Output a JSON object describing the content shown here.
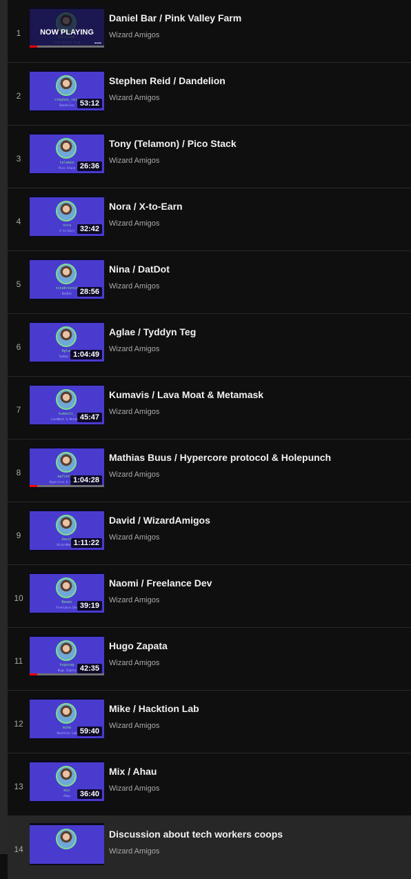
{
  "playlist": {
    "channel": "Wizard Amigos",
    "now_playing_label": "NOW PLAYING",
    "now_playing_dots": "---",
    "items": [
      {
        "index": "1",
        "title": "Daniel Bar / Pink Valley Farm",
        "duration": "",
        "thumb_name": "danielbar",
        "thumb_sub": "Pink Valley Farm",
        "progress": 0.1,
        "now_playing": true
      },
      {
        "index": "2",
        "title": "Stephen Reid / Dandelion",
        "duration": "53:12",
        "thumb_name": "stephen_reid",
        "thumb_sub": "Dandelion",
        "progress": 0
      },
      {
        "index": "3",
        "title": "Tony (Telamon) / Pico Stack",
        "duration": "26:36",
        "thumb_name": "telamon",
        "thumb_sub": "Pico Stack",
        "progress": 0
      },
      {
        "index": "4",
        "title": "Nora / X-to-Earn",
        "duration": "32:42",
        "thumb_name": "nora",
        "thumb_sub": "X-to-Earn",
        "progress": 0
      },
      {
        "index": "5",
        "title": "Nina / DatDot",
        "duration": "28:56",
        "thumb_name": "ninabreznik",
        "thumb_sub": "DatDot",
        "progress": 0
      },
      {
        "index": "6",
        "title": "Aglae / Tyddyn Teg",
        "duration": "1:04:49",
        "thumb_name": "Aglae",
        "thumb_sub": "Tyddyn Teg",
        "progress": 0
      },
      {
        "index": "7",
        "title": "Kumavis / Lava Moat & Metamask",
        "duration": "45:47",
        "thumb_name": "kumavis_",
        "thumb_sub": "LavaMoat & Metamask",
        "progress": 0
      },
      {
        "index": "8",
        "title": "Mathias Buus / Hypercore protocol & Holepunch",
        "duration": "1:04:28",
        "thumb_name": "mafintosh",
        "thumb_sub": "Hypercore & Holepunch",
        "progress": 0.1
      },
      {
        "index": "9",
        "title": "David / WizardAmigos",
        "duration": "1:11:22",
        "thumb_name": "david",
        "thumb_sub": "WizardAmigos",
        "progress": 0
      },
      {
        "index": "10",
        "title": "Naomi / Freelance Dev",
        "duration": "39:19",
        "thumb_name": "Naomi",
        "thumb_sub": "Freelance Dev",
        "progress": 0
      },
      {
        "index": "11",
        "title": "Hugo Zapata",
        "duration": "42:35",
        "thumb_name": "hugozap",
        "thumb_sub": "Hugo Zapata",
        "progress": 0.1
      },
      {
        "index": "12",
        "title": "Mike / Hacktion Lab",
        "duration": "59:40",
        "thumb_name": "mike",
        "thumb_sub": "Hacktion Lab",
        "progress": 0
      },
      {
        "index": "13",
        "title": "Mix / Ahau",
        "duration": "36:40",
        "thumb_name": "mix",
        "thumb_sub": "Ahau",
        "progress": 0
      },
      {
        "index": "14",
        "title": "Discussion about tech workers coops",
        "duration": "",
        "thumb_name": "",
        "thumb_sub": "",
        "progress": 0,
        "active": true
      }
    ]
  }
}
